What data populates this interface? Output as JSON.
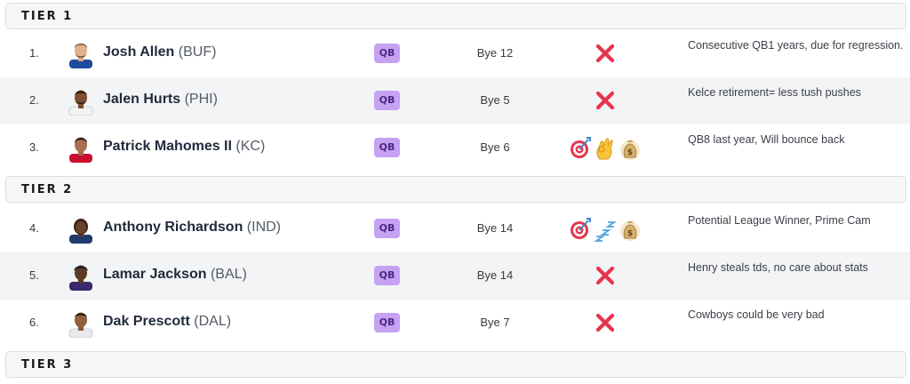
{
  "tiers": [
    {
      "label": "TIER 1"
    },
    {
      "label": "TIER 2"
    },
    {
      "label": "TIER 3"
    }
  ],
  "players": [
    {
      "rank": "1.",
      "name": "Josh Allen",
      "team": "(BUF)",
      "position": "QB",
      "bye": "Bye 12",
      "flag": "x-mark",
      "note": "Consecutive QB1 years, due for regression."
    },
    {
      "rank": "2.",
      "name": "Jalen Hurts",
      "team": "(PHI)",
      "position": "QB",
      "bye": "Bye 5",
      "flag": "x-mark",
      "note": "Kelce retirement= less tush pushes"
    },
    {
      "rank": "3.",
      "name": "Patrick Mahomes II",
      "team": "(KC)",
      "position": "QB",
      "bye": "Bye 6",
      "flag": "target, ok-hand, money-bag",
      "note": "QB8 last year, Will bounce back"
    },
    {
      "rank": "4.",
      "name": "Anthony Richardson",
      "team": "(IND)",
      "position": "QB",
      "bye": "Bye 14",
      "flag": "target, zzz, money-bag",
      "note": "Potential League Winner, Prime Cam"
    },
    {
      "rank": "5.",
      "name": "Lamar Jackson",
      "team": "(BAL)",
      "position": "QB",
      "bye": "Bye 14",
      "flag": "x-mark",
      "note": "Henry steals tds, no care about stats"
    },
    {
      "rank": "6.",
      "name": "Dak Prescott",
      "team": "(DAL)",
      "position": "QB",
      "bye": "Bye 7",
      "flag": "x-mark",
      "note": "Cowboys could be very bad"
    }
  ],
  "colors": {
    "position_badge_bg": "#c6a2f2",
    "x_mark": "#e8344e",
    "tier_bg": "#f6f6f7",
    "row_shade": "#f3f4f6"
  }
}
